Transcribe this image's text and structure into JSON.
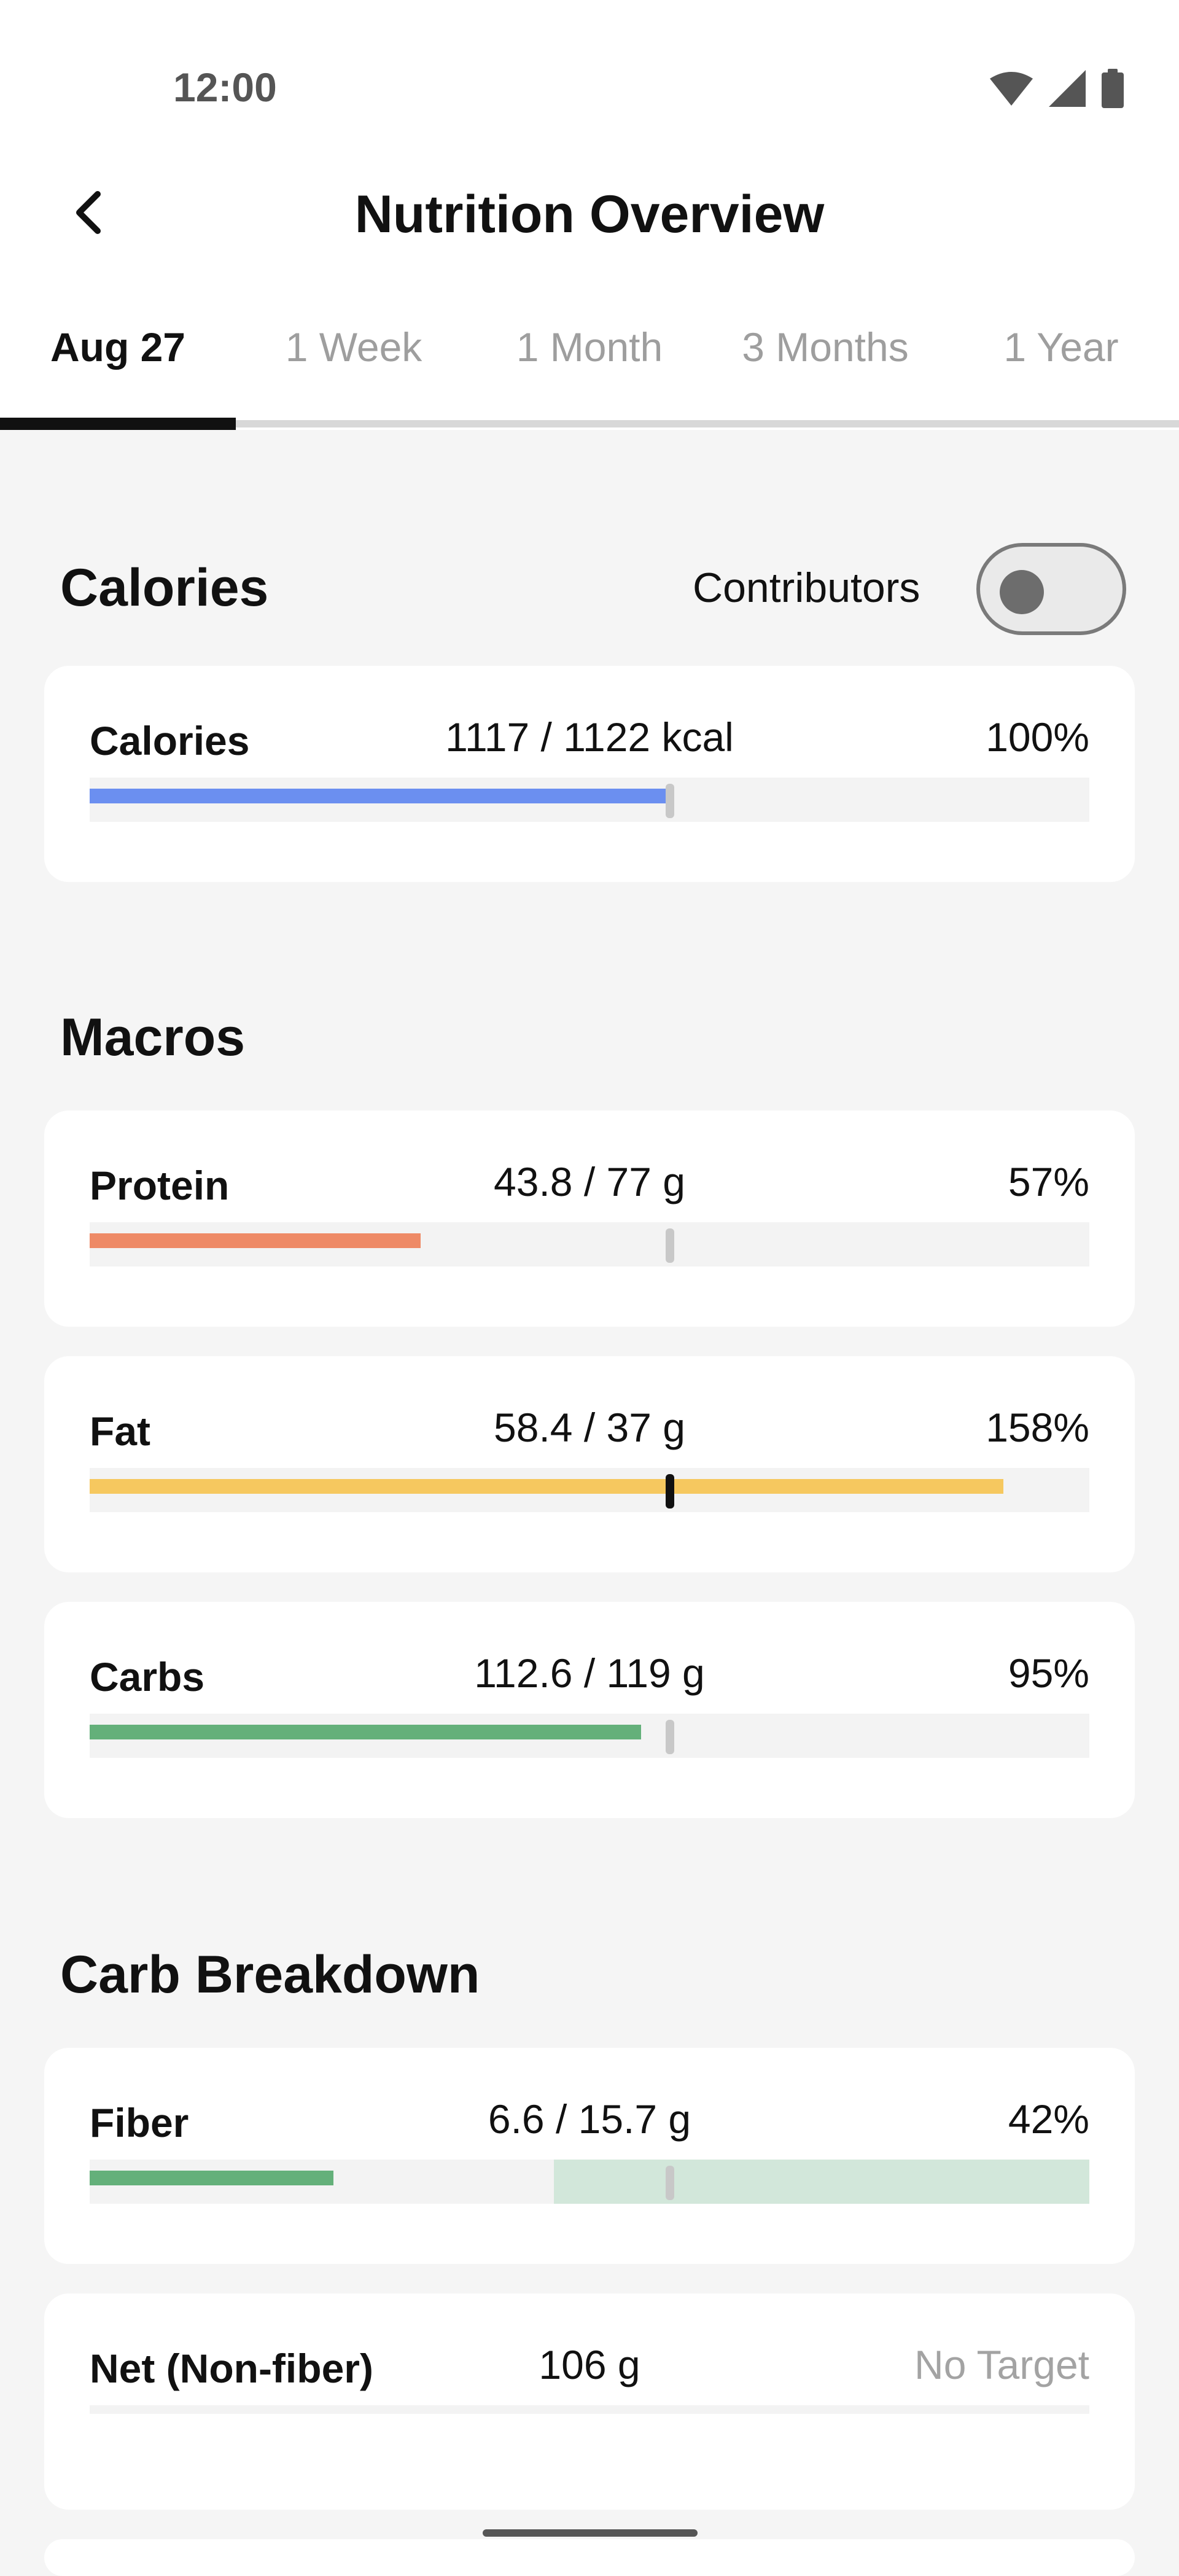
{
  "status_bar": {
    "time": "12:00",
    "icons": [
      "wifi-icon",
      "signal-icon",
      "battery-icon"
    ]
  },
  "header": {
    "title": "Nutrition Overview",
    "back_icon": "chevron-left-icon"
  },
  "tabs": [
    {
      "label": "Aug 27",
      "active": true
    },
    {
      "label": "1 Week",
      "active": false
    },
    {
      "label": "1 Month",
      "active": false
    },
    {
      "label": "3 Months",
      "active": false
    },
    {
      "label": "1 Year",
      "active": false
    }
  ],
  "sections": {
    "calories": {
      "title": "Calories",
      "contributors_label": "Contributors",
      "contributors_on": false,
      "item": {
        "label": "Calories",
        "amount": "1117 / 1122 kcal",
        "percent": "100%",
        "fill_fraction": 1.0,
        "color": "#6b8ff0"
      }
    },
    "macros": {
      "title": "Macros",
      "items": [
        {
          "label": "Protein",
          "amount": "43.8 / 77 g",
          "percent": "57%",
          "fill_fraction": 0.57,
          "color": "#ee8a66"
        },
        {
          "label": "Fat",
          "amount": "58.4 / 37 g",
          "percent": "158%",
          "fill_fraction": 1.58,
          "color": "#f6c85f"
        },
        {
          "label": "Carbs",
          "amount": "112.6 / 119 g",
          "percent": "95%",
          "fill_fraction": 0.95,
          "color": "#64b07a"
        }
      ]
    },
    "carb_breakdown": {
      "title": "Carb Breakdown",
      "items": [
        {
          "label": "Fiber",
          "amount": "6.6 / 15.7 g",
          "percent": "42%",
          "fill_fraction": 0.42,
          "color": "#64b07a"
        },
        {
          "label": "Net (Non-fiber)",
          "amount": "106 g",
          "percent": "No Target"
        }
      ]
    }
  }
}
